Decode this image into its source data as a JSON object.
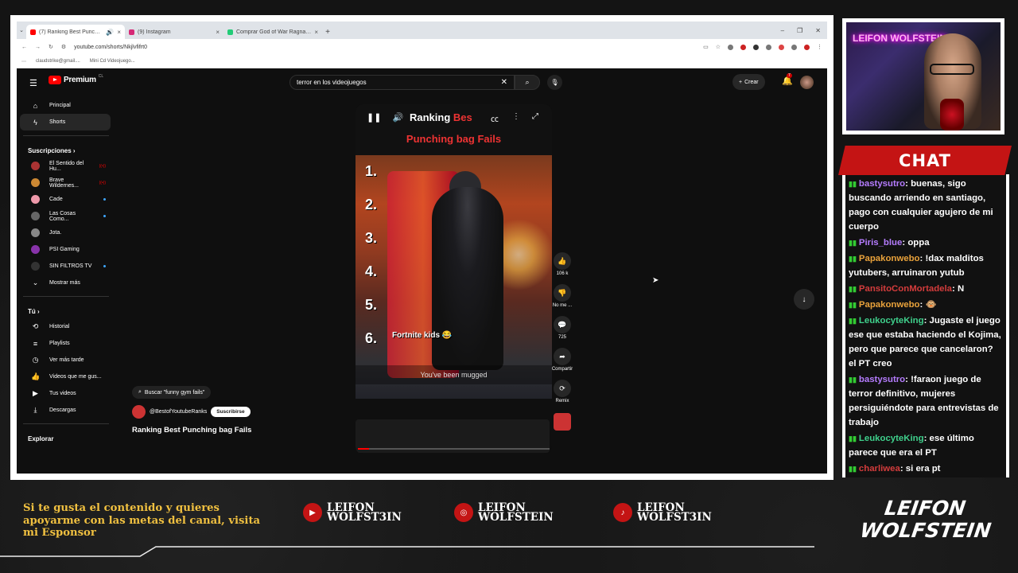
{
  "browser": {
    "tabs": [
      {
        "label": "(7) Ranking Best Punching",
        "color": "#f00",
        "active": true
      },
      {
        "label": "(9) Instagram",
        "color": "#d62976",
        "active": false
      },
      {
        "label": "Comprar God of War Ragnarök",
        "color": "#2c7",
        "active": false
      }
    ],
    "url": "youtube.com/shorts/Nkjlvfifrt0",
    "bookmarks": [
      "claudstrike@gmail....",
      "Mini Cd Videojuego..."
    ]
  },
  "youtube": {
    "logo": "Premium",
    "logo_region": "CL",
    "search_query": "terror en los videojuegos",
    "create_label": "Crear",
    "notif_count": "7",
    "sidebar": {
      "main": [
        {
          "label": "Principal",
          "icon": "home-icon"
        },
        {
          "label": "Shorts",
          "icon": "shorts-icon"
        }
      ],
      "subs_title": "Suscripciones",
      "subs": [
        {
          "label": "El Sentido del Hu...",
          "color": "#a33",
          "status": "live"
        },
        {
          "label": "Brave Wildernes...",
          "color": "#c83",
          "status": "live"
        },
        {
          "label": "Cade",
          "color": "#e9a",
          "status": "dot"
        },
        {
          "label": "Las Cosas Como...",
          "color": "#666",
          "status": "dot"
        },
        {
          "label": "Jota.",
          "color": "#888",
          "status": ""
        },
        {
          "label": "PSI Gaming",
          "color": "#83a",
          "status": ""
        },
        {
          "label": "SIN FILTROS TV",
          "color": "#333",
          "status": "dot"
        }
      ],
      "show_more": "Mostrar más",
      "you_title": "Tú",
      "you": [
        {
          "label": "Historial",
          "icon": "history-icon"
        },
        {
          "label": "Playlists",
          "icon": "playlists-icon"
        },
        {
          "label": "Ver más tarde",
          "icon": "watch-later-icon"
        },
        {
          "label": "Videos que me gus...",
          "icon": "like-icon"
        },
        {
          "label": "Tus videos",
          "icon": "my-videos-icon"
        },
        {
          "label": "Descargas",
          "icon": "downloads-icon"
        }
      ],
      "explore_title": "Explorar"
    },
    "short": {
      "title_a": "Ranking ",
      "title_b": "Bes",
      "subtitle": "Punching bag Fails",
      "numbers": [
        "1.",
        "2.",
        "3.",
        "4.",
        "5.",
        "6."
      ],
      "caption": "Fortnite kids 😂",
      "overlay": "You've been mugged",
      "progress": 0.06
    },
    "actions": [
      {
        "label": "106 k",
        "icon": "like-icon",
        "glyph": "👍"
      },
      {
        "label": "No me ...",
        "icon": "dislike-icon",
        "glyph": "👎"
      },
      {
        "label": "725",
        "icon": "comments-icon",
        "glyph": "💬"
      },
      {
        "label": "Compartir",
        "icon": "share-icon",
        "glyph": "➦"
      },
      {
        "label": "Remix",
        "icon": "remix-icon",
        "glyph": "⟳"
      }
    ],
    "meta": {
      "search_pill": "Buscar \"funny gym fails\"",
      "channel": "@BestofYoutubeRanks",
      "subscribe": "Suscribirse",
      "title": "Ranking Best Punching bag Fails"
    }
  },
  "stream": {
    "cam_text": "LEIFON WOLFSTEIN",
    "chat_title": "CHAT",
    "chat": [
      {
        "user": "bastysutro",
        "color": "#b57cff",
        "text": ": buenas, sigo buscando arriendo en santiago, pago con cualquier agujero de mi cuerpo"
      },
      {
        "user": "Piris_blue",
        "color": "#b57cff",
        "text": ": oppa"
      },
      {
        "user": "Papakonwebo",
        "color": "#e9a23b",
        "text": ": !dax malditos yutubers, arruinaron yutub"
      },
      {
        "user": "PansitoConMortadela",
        "color": "#d43c3c",
        "text": ": N"
      },
      {
        "user": "Papakonwebo",
        "color": "#e9a23b",
        "text": ": 🐵"
      },
      {
        "user": "LeukocyteKing",
        "color": "#3fd08c",
        "text": ": Jugaste el juego ese que estaba haciendo el Kojima, pero que parece que cancelaron? el PT creo"
      },
      {
        "user": "bastysutro",
        "color": "#b57cff",
        "text": ": !faraon juego de terror definitivo, mujeres persiguiéndote para entrevistas de trabajo"
      },
      {
        "user": "LeukocyteKing",
        "color": "#3fd08c",
        "text": ": ese último parece que era el PT"
      },
      {
        "user": "charliwea",
        "color": "#d43c3c",
        "text": ": si era pt"
      }
    ],
    "footer_text": "Si te gusta el contenido y quieres apoyarme con las metas del canal, visita mi Esponsor",
    "socials": [
      {
        "line1": "LEIFON",
        "line2": "WOLFST3IN",
        "icon": "youtube-icon",
        "glyph": "▶"
      },
      {
        "line1": "LEIFON",
        "line2": "WOLFSTEIN",
        "icon": "instagram-icon",
        "glyph": "◎"
      },
      {
        "line1": "LEIFON",
        "line2": "WOLFST3IN",
        "icon": "tiktok-icon",
        "glyph": "♪"
      }
    ],
    "brand_line1": "LEIFON",
    "brand_line2": "WOLFSTEIN"
  }
}
